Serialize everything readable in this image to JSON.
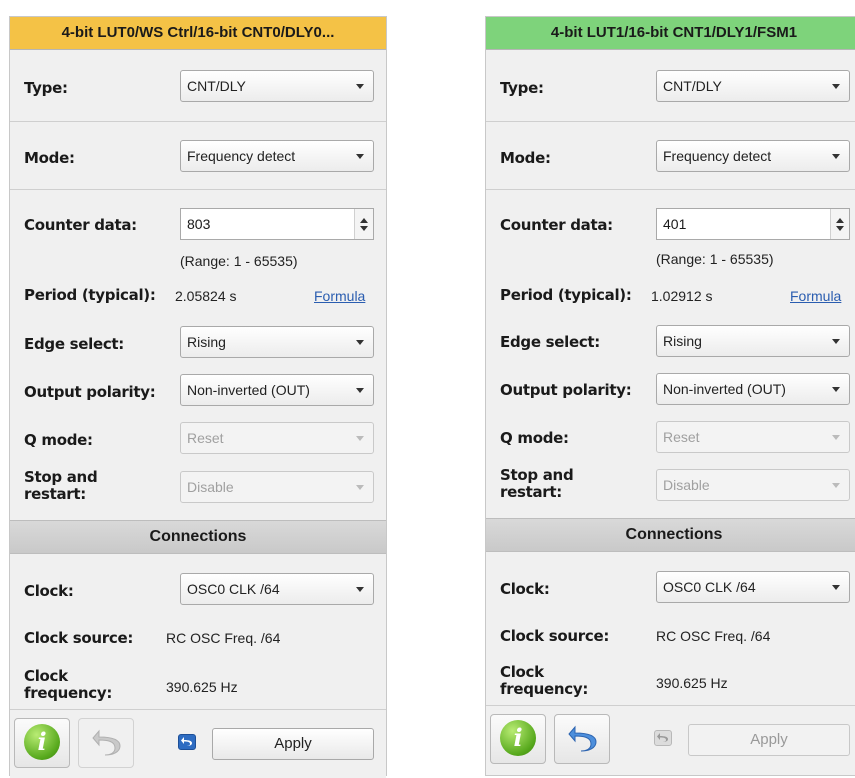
{
  "panels": [
    {
      "title": "4-bit LUT0/WS Ctrl/16-bit CNT0/DLY0...",
      "title_color": "#f4c246",
      "type_label": "Type:",
      "type_value": "CNT/DLY",
      "mode_label": "Mode:",
      "mode_value": "Frequency detect",
      "counter_label": "Counter data:",
      "counter_value": "803",
      "range_text": "(Range:  1 - 65535)",
      "period_label": "Period (typical):",
      "period_value": "2.05824 s",
      "formula_link": "Formula",
      "edge_label": "Edge select:",
      "edge_value": "Rising",
      "polarity_label": "Output polarity:",
      "polarity_value": "Non-inverted (OUT)",
      "qmode_label": "Q mode:",
      "qmode_value": "Reset",
      "stop_label_1": "Stop and",
      "stop_label_2": "restart:",
      "stop_value": "Disable",
      "connections_header": "Connections",
      "clock_label": "Clock:",
      "clock_value": "OSC0 CLK /64",
      "clock_source_label": "Clock source:",
      "clock_source_value": "RC OSC Freq. /64",
      "clock_freq_label_1": "Clock",
      "clock_freq_label_2": "frequency:",
      "clock_freq_value": "390.625 Hz",
      "info_glyph": "i",
      "apply_label": "Apply",
      "undo_enabled": false,
      "apply_enabled": true
    },
    {
      "title": "4-bit LUT1/16-bit CNT1/DLY1/FSM1",
      "title_color": "#7ed37b",
      "type_label": "Type:",
      "type_value": "CNT/DLY",
      "mode_label": "Mode:",
      "mode_value": "Frequency detect",
      "counter_label": "Counter data:",
      "counter_value": "401",
      "range_text": "(Range:  1 - 65535)",
      "period_label": "Period (typical):",
      "period_value": "1.02912 s",
      "formula_link": "Formula",
      "edge_label": "Edge select:",
      "edge_value": "Rising",
      "polarity_label": "Output polarity:",
      "polarity_value": "Non-inverted (OUT)",
      "qmode_label": "Q mode:",
      "qmode_value": "Reset",
      "stop_label_1": "Stop and",
      "stop_label_2": "restart:",
      "stop_value": "Disable",
      "connections_header": "Connections",
      "clock_label": "Clock:",
      "clock_value": "OSC0 CLK /64",
      "clock_source_label": "Clock source:",
      "clock_source_value": "RC OSC Freq. /64",
      "clock_freq_label_1": "Clock",
      "clock_freq_label_2": "frequency:",
      "clock_freq_value": "390.625 Hz",
      "info_glyph": "i",
      "apply_label": "Apply",
      "undo_enabled": true,
      "apply_enabled": false
    }
  ]
}
